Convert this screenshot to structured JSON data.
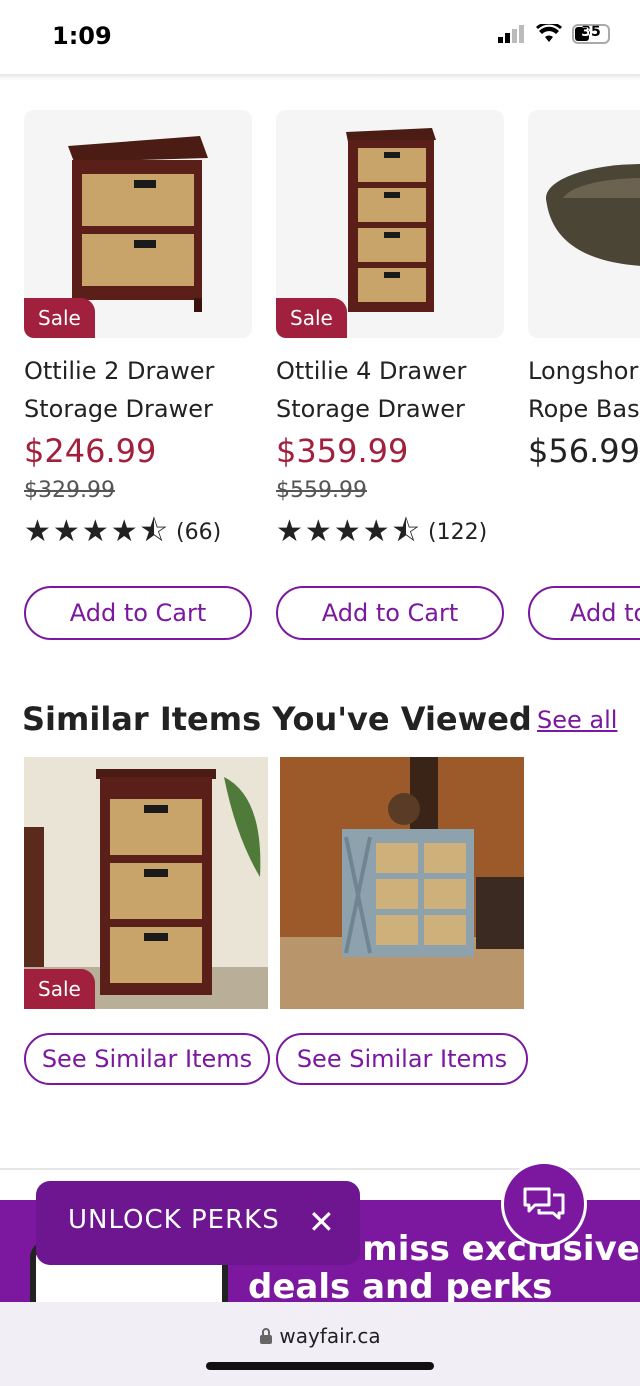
{
  "status_bar": {
    "time": "1:09",
    "battery": "35"
  },
  "products": [
    {
      "badge": "Sale",
      "name_line1": "Ottilie 2 Drawer",
      "name_line2": "Storage Drawer",
      "price": "$246.99",
      "old_price": "$329.99",
      "rating_count": "(66)",
      "rating": 4.5,
      "button": "Add to Cart"
    },
    {
      "badge": "Sale",
      "name_line1": "Ottilie 4 Drawer",
      "name_line2": "Storage Drawer",
      "price": "$359.99",
      "old_price": "$559.99",
      "rating_count": "(122)",
      "rating": 4.5,
      "button": "Add to Cart"
    },
    {
      "name_line1": "Longshor",
      "name_line2": "Rope Bas",
      "price": "$56.99",
      "button": "Add to"
    }
  ],
  "similar": {
    "title": "Similar Items You've Viewed",
    "see_all": "See all",
    "items": [
      {
        "badge": "Sale",
        "button": "See Similar Items"
      },
      {
        "button": "See Similar Items"
      }
    ]
  },
  "promo": {
    "unlock_label": "UNLOCK PERKS",
    "banner_line1": "Don't miss exclusive",
    "banner_line2": "deals and perks"
  },
  "browser": {
    "url": "wayfair.ca"
  },
  "colors": {
    "brand_purple": "#7b189f",
    "sale_red": "#a1203d"
  }
}
